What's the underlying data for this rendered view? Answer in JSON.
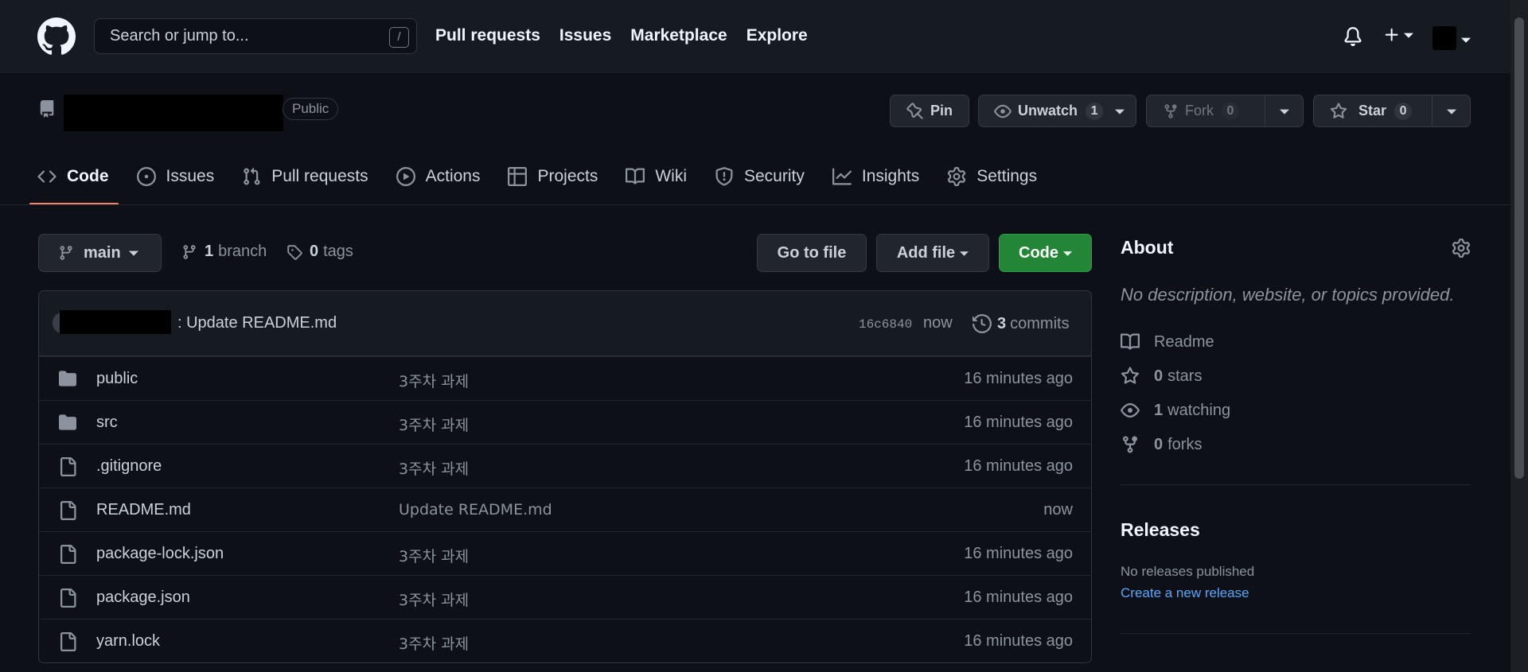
{
  "header": {
    "search_placeholder": "Search or jump to...",
    "search_shortcut": "/",
    "nav": [
      "Pull requests",
      "Issues",
      "Marketplace",
      "Explore"
    ]
  },
  "repo": {
    "visibility": "Public",
    "pin_label": "Pin",
    "unwatch_label": "Unwatch",
    "watch_count": "1",
    "fork_label": "Fork",
    "fork_count": "0",
    "star_label": "Star",
    "star_count": "0"
  },
  "tabs": [
    "Code",
    "Issues",
    "Pull requests",
    "Actions",
    "Projects",
    "Wiki",
    "Security",
    "Insights",
    "Settings"
  ],
  "filenav": {
    "branch": "main",
    "branch_count": "1",
    "branch_word": "branch",
    "tag_count": "0",
    "tag_word": "tags",
    "goto_file": "Go to file",
    "add_file": "Add file",
    "code": "Code"
  },
  "commit": {
    "message": ": Update README.md",
    "sha": "16c6840",
    "time": "now",
    "count": "3",
    "count_word": "commits"
  },
  "files": [
    {
      "type": "dir",
      "name": "public",
      "message": "3주차 과제",
      "age": "16 minutes ago"
    },
    {
      "type": "dir",
      "name": "src",
      "message": "3주차 과제",
      "age": "16 minutes ago"
    },
    {
      "type": "file",
      "name": ".gitignore",
      "message": "3주차 과제",
      "age": "16 minutes ago"
    },
    {
      "type": "file",
      "name": "README.md",
      "message": "Update README.md",
      "age": "now"
    },
    {
      "type": "file",
      "name": "package-lock.json",
      "message": "3주차 과제",
      "age": "16 minutes ago"
    },
    {
      "type": "file",
      "name": "package.json",
      "message": "3주차 과제",
      "age": "16 minutes ago"
    },
    {
      "type": "file",
      "name": "yarn.lock",
      "message": "3주차 과제",
      "age": "16 minutes ago"
    }
  ],
  "about": {
    "title": "About",
    "description": "No description, website, or topics provided.",
    "readme": "Readme",
    "stars_count": "0",
    "stars_word": "stars",
    "watching_count": "1",
    "watching_word": "watching",
    "forks_count": "0",
    "forks_word": "forks"
  },
  "releases": {
    "title": "Releases",
    "none": "No releases published",
    "create_link": "Create a new release"
  },
  "colors": {
    "bg": "#0d1117",
    "header_bg": "#161b22",
    "accent_tab": "#f78166",
    "code_btn": "#238636",
    "link": "#58a6ff"
  }
}
